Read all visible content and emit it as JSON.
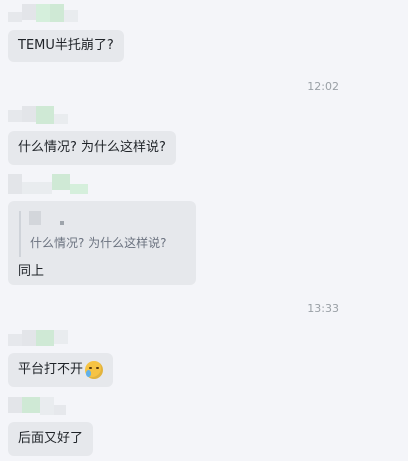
{
  "messages": [
    {
      "text": "TEMU半托崩了?"
    },
    {
      "time": "12:02"
    },
    {
      "text": "什么情况? 为什么这样说?"
    },
    {
      "quote": "什么情况? 为什么这样说?",
      "reply": "同上"
    },
    {
      "time": "13:33"
    },
    {
      "text": "平台打不开",
      "emoji": "crying-laughing-emoji"
    },
    {
      "text": "后面又好了"
    }
  ],
  "colors": {
    "background": "#f4f5f9",
    "bubble": "#e6e8ec",
    "text": "#1f2328",
    "timestamp": "#9aa0a6",
    "avatar_blur_green": "#cfe9d5",
    "avatar_blur_grey": "#e3e5e9"
  }
}
